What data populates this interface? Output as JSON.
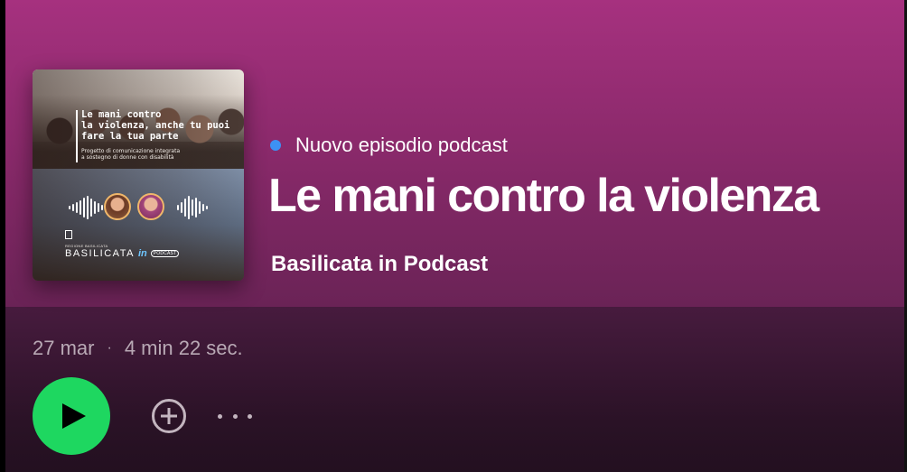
{
  "episode": {
    "badge": "Nuovo episodio podcast",
    "title": "Le mani contro la violenza",
    "show": "Basilicata in Podcast",
    "date": "27 mar",
    "duration": "4 min 22 sec.",
    "separator": "·"
  },
  "cover": {
    "title_lines": [
      "Le mani contro",
      "la violenza, anche tu puoi",
      "fare la tua parte"
    ],
    "subtitle_lines": [
      "Progetto di comunicazione integrata",
      "a sostegno di donne con disabilità"
    ],
    "region_label": "REGIONE BASILICATA",
    "brand": "BASILICATA",
    "brand_in": "in",
    "brand_podcast": "PODCAST"
  },
  "controls": {
    "play_icon": "play-icon",
    "add_icon": "add-circle-icon",
    "more_icon": "more-horizontal-icon"
  },
  "colors": {
    "accent_green": "#1ed760",
    "new_dot_blue": "#3d91f4",
    "header_top": "#a6317f",
    "header_bottom": "#6a2356"
  }
}
